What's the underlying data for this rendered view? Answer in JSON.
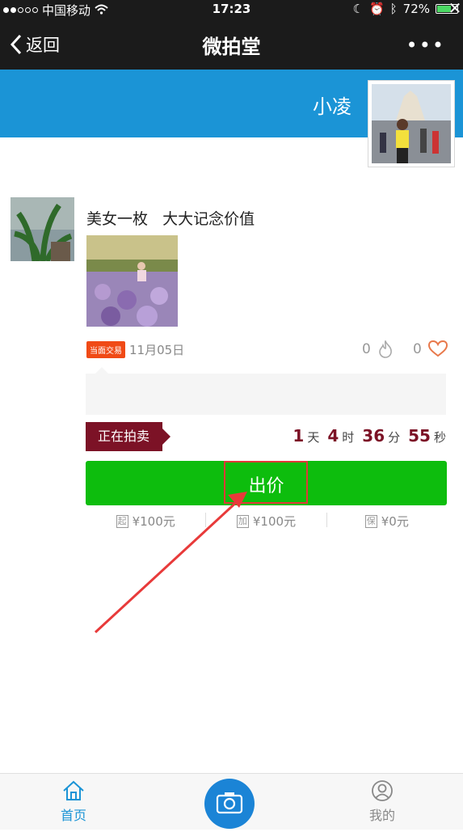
{
  "status": {
    "carrier": "中国移动",
    "time": "17:23",
    "battery": "72%",
    "battery_level": 0.72
  },
  "nav": {
    "back_label": "返回",
    "title": "微拍堂"
  },
  "profile": {
    "name": "小凌"
  },
  "post": {
    "text": "美女一枚   大大记念价值",
    "badge": "当面交易",
    "date": "11月05日",
    "fire_count": "0",
    "like_count": "0",
    "auction_status": "正在拍卖",
    "countdown": {
      "days": "1",
      "days_unit": "天",
      "hours": "4",
      "hours_unit": "时",
      "minutes": "36",
      "minutes_unit": "分",
      "seconds": "55",
      "seconds_unit": "秒"
    },
    "bid_label": "出价",
    "prices": [
      {
        "icon": "起",
        "value": "¥100元"
      },
      {
        "icon": "加",
        "value": "¥100元"
      },
      {
        "icon": "保",
        "value": "¥0元"
      }
    ]
  },
  "tabbar": {
    "home_label": "首页",
    "me_label": "我的"
  },
  "colors": {
    "brand_blue": "#1b94d6",
    "bid_green": "#0dbd0d",
    "auction_red": "#7c1226",
    "badge_orange": "#f04a16"
  }
}
